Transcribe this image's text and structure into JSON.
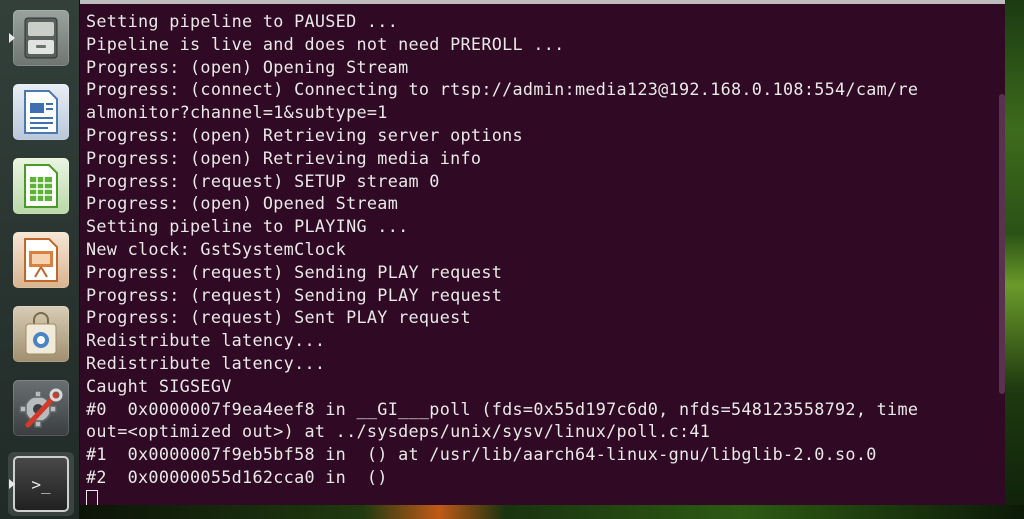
{
  "launcher": {
    "items": [
      {
        "name": "files",
        "icon": "file-cabinet-icon"
      },
      {
        "name": "libreoffice-writer",
        "icon": "document-icon"
      },
      {
        "name": "libreoffice-calc",
        "icon": "spreadsheet-icon"
      },
      {
        "name": "libreoffice-impress",
        "icon": "presentation-icon"
      },
      {
        "name": "ubuntu-software",
        "icon": "shopping-bag-icon"
      },
      {
        "name": "system-settings",
        "icon": "gear-wrench-icon"
      },
      {
        "name": "terminal",
        "icon": "terminal-icon",
        "active": true
      }
    ],
    "terminal_glyph": ">_"
  },
  "terminal": {
    "background": "#300a24",
    "foreground": "#e8e8e8",
    "lines": [
      "Setting pipeline to PAUSED ...",
      "Pipeline is live and does not need PREROLL ...",
      "Progress: (open) Opening Stream",
      "Progress: (connect) Connecting to rtsp://admin:media123@192.168.0.108:554/cam/re",
      "almonitor?channel=1&subtype=1",
      "Progress: (open) Retrieving server options",
      "Progress: (open) Retrieving media info",
      "Progress: (request) SETUP stream 0",
      "Progress: (open) Opened Stream",
      "Setting pipeline to PLAYING ...",
      "New clock: GstSystemClock",
      "Progress: (request) Sending PLAY request",
      "Progress: (request) Sending PLAY request",
      "Progress: (request) Sent PLAY request",
      "Redistribute latency...",
      "Redistribute latency...",
      "Caught SIGSEGV",
      "#0  0x0000007f9ea4eef8 in __GI___poll (fds=0x55d197c6d0, nfds=548123558792, time",
      "out=<optimized out>) at ../sysdeps/unix/sysv/linux/poll.c:41",
      "#1  0x0000007f9eb5bf58 in  () at /usr/lib/aarch64-linux-gnu/libglib-2.0.so.0",
      "#2  0x00000055d162cca0 in  ()"
    ]
  }
}
